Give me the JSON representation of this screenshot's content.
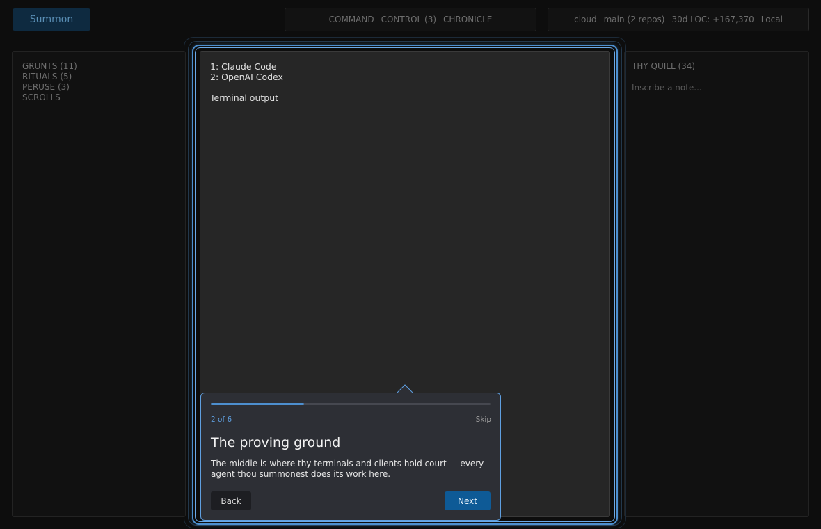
{
  "header": {
    "summon_label": "Summon",
    "tabs": [
      {
        "label": "COMMAND"
      },
      {
        "label": "CONTROL (3)"
      },
      {
        "label": "CHRONICLE"
      }
    ],
    "status": {
      "env": "cloud",
      "branch": "main (2 repos)",
      "loc": "30d LOC: +167,370",
      "mode": "Local"
    }
  },
  "left_panel": {
    "items": [
      {
        "label": "GRUNTS (11)"
      },
      {
        "label": "RITUALS (5)"
      },
      {
        "label": "PERUSE (3)"
      },
      {
        "label": "SCROLLS"
      }
    ]
  },
  "center_panel": {
    "clients": [
      {
        "label": "1: Claude Code"
      },
      {
        "label": "2: OpenAI Codex"
      }
    ],
    "terminal_label": "Terminal output"
  },
  "right_panel": {
    "title": "THY QUILL (34)",
    "note_placeholder": "Inscribe a note..."
  },
  "tour": {
    "step": "2 of 6",
    "progress": 0.333,
    "skip_label": "Skip",
    "title": "The proving ground",
    "body": "The middle is where thy terminals and clients hold court — every agent thou summonest does its work here.",
    "back_label": "Back",
    "next_label": "Next"
  },
  "colors": {
    "accent": "#4d8fcf",
    "primary_button": "#0e5a96",
    "background": "#0d0d0d"
  }
}
